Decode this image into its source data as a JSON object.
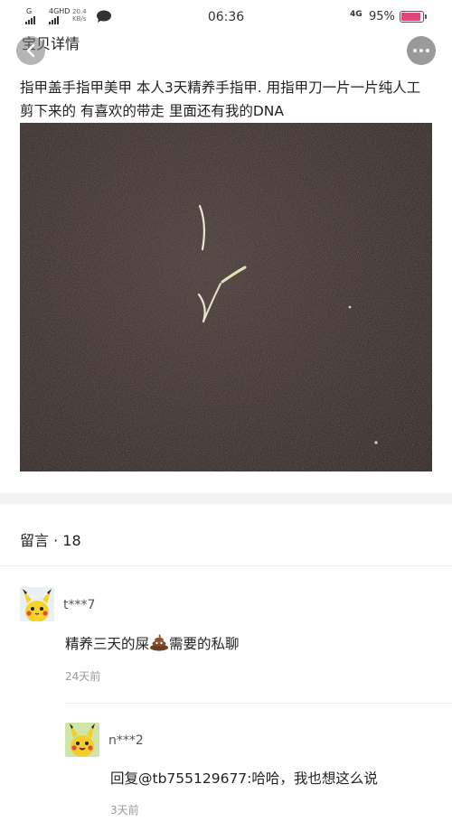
{
  "status_bar": {
    "signal_label": "G",
    "network_label": "4GHD",
    "net_speed": "20.4 KB/s",
    "time": "06:36",
    "network_right": "4G",
    "battery_pct": "95%",
    "battery_level": 0.95,
    "battery_color": "#e0457b"
  },
  "nav": {
    "title": "宝贝详情",
    "back_icon": "back-arrow-icon",
    "more_icon": "more-dots-icon"
  },
  "item": {
    "description": "指甲盖手指甲美甲  本人3天精养手指甲. 用指甲刀一片一片纯人工剪下来的 有喜欢的带走 里面还有我的DNA"
  },
  "comments": {
    "header": "留言 · 18",
    "list": [
      {
        "user": "t***7",
        "text_before": "精养三天的屎",
        "emoji": "poop-emoji-icon",
        "text_after": "需要的私聊",
        "time": "24天前"
      },
      {
        "user": "n***2",
        "text": "回复@tb755129677:哈哈，我也想这么说",
        "time": "3天前"
      }
    ]
  }
}
